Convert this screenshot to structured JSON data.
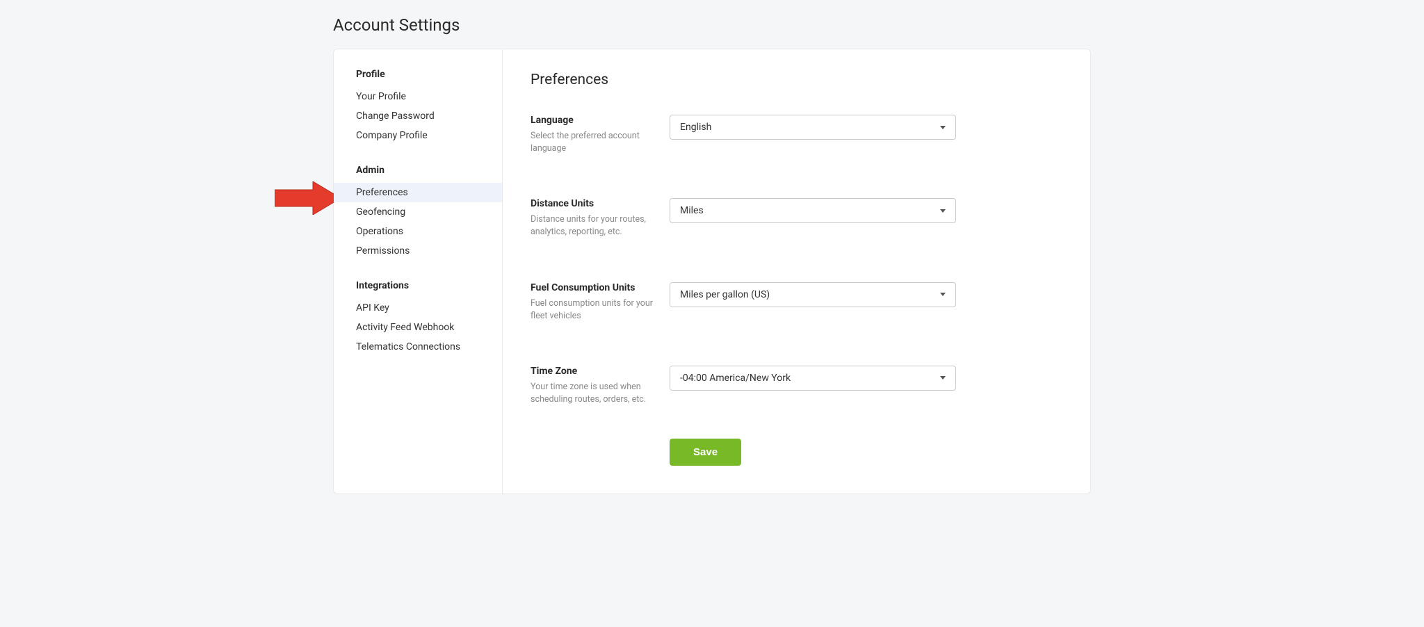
{
  "page": {
    "title": "Account Settings"
  },
  "sidebar": {
    "sections": [
      {
        "heading": "Profile",
        "items": [
          {
            "label": "Your Profile",
            "active": false
          },
          {
            "label": "Change Password",
            "active": false
          },
          {
            "label": "Company Profile",
            "active": false
          }
        ]
      },
      {
        "heading": "Admin",
        "items": [
          {
            "label": "Preferences",
            "active": true
          },
          {
            "label": "Geofencing",
            "active": false
          },
          {
            "label": "Operations",
            "active": false
          },
          {
            "label": "Permissions",
            "active": false
          }
        ]
      },
      {
        "heading": "Integrations",
        "items": [
          {
            "label": "API Key",
            "active": false
          },
          {
            "label": "Activity Feed Webhook",
            "active": false
          },
          {
            "label": "Telematics Connections",
            "active": false
          }
        ]
      }
    ]
  },
  "main": {
    "title": "Preferences",
    "fields": [
      {
        "label": "Language",
        "help": "Select the preferred account language",
        "value": "English"
      },
      {
        "label": "Distance Units",
        "help": "Distance units for your routes, analytics, reporting, etc.",
        "value": "Miles"
      },
      {
        "label": "Fuel Consumption Units",
        "help": "Fuel consumption units for your fleet vehicles",
        "value": "Miles per gallon (US)"
      },
      {
        "label": "Time Zone",
        "help": "Your time zone is used when scheduling routes, orders, etc.",
        "value": "-04:00 America/New York"
      }
    ],
    "save_label": "Save"
  }
}
